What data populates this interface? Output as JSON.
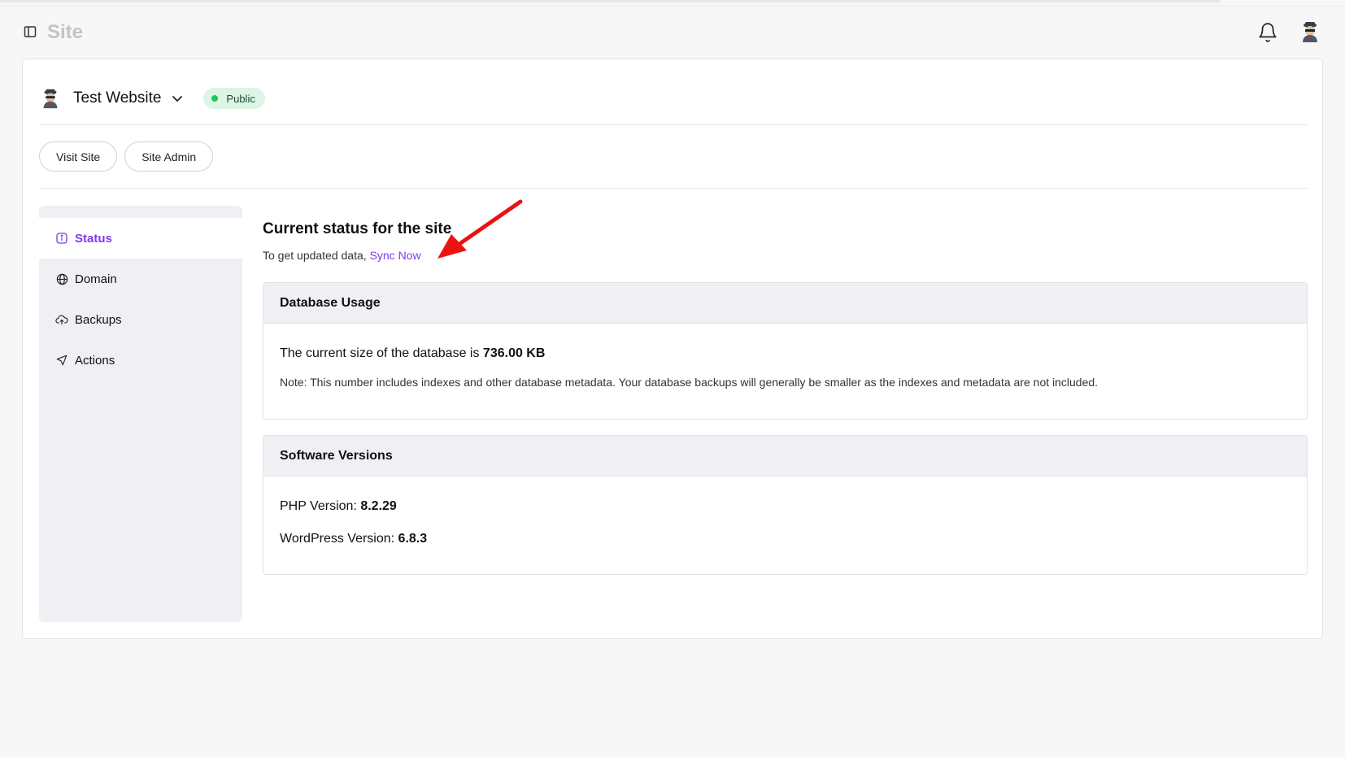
{
  "header": {
    "title": "Site",
    "icons": {
      "toggle": "sidebar-toggle-icon",
      "bell": "bell-icon",
      "avatar": "user-avatar"
    }
  },
  "site": {
    "name": "Test Website",
    "status": "Public",
    "status_color": "#22c55e",
    "buttons": {
      "visit": "Visit Site",
      "admin": "Site Admin"
    }
  },
  "sidebar": {
    "items": [
      {
        "label": "Status",
        "icon": "info-icon",
        "active": true
      },
      {
        "label": "Domain",
        "icon": "globe-icon",
        "active": false
      },
      {
        "label": "Backups",
        "icon": "cloud-icon",
        "active": false
      },
      {
        "label": "Actions",
        "icon": "send-icon",
        "active": false
      }
    ]
  },
  "main": {
    "title": "Current status for the site",
    "sub_text": "To get updated data,",
    "sync_link": "Sync Now",
    "accent": "#7c3aed",
    "database": {
      "heading": "Database Usage",
      "size_text": "The current size of the database is",
      "size_value": "736.00 KB",
      "note": "Note: This number includes indexes and other database metadata. Your database backups will generally be smaller as the indexes and metadata are not included."
    },
    "software": {
      "heading": "Software Versions",
      "php_label": "PHP Version:",
      "php_value": "8.2.29",
      "wp_label": "WordPress Version:",
      "wp_value": "6.8.3"
    }
  }
}
